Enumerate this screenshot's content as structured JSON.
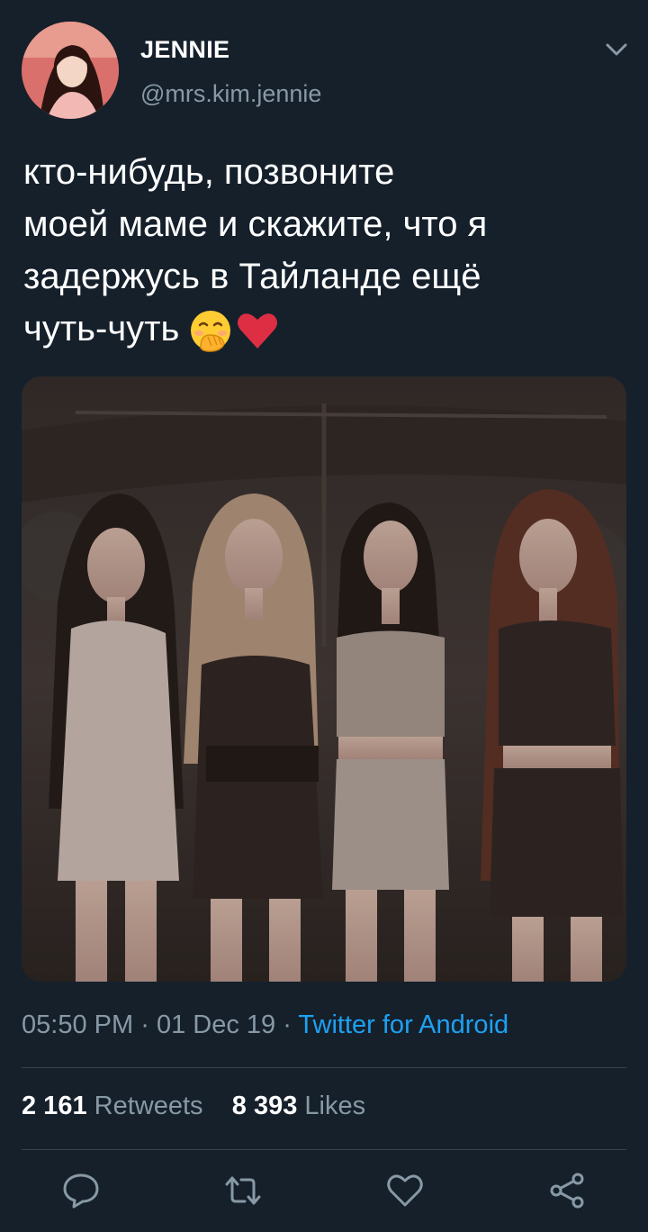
{
  "tweet": {
    "author": {
      "display_name": "JENNIE",
      "handle": "@mrs.kim.jennie"
    },
    "text_lines": [
      "кто-нибудь, позвоните",
      "моей маме и скажите, что я",
      "задержусь в Тайланде ещё",
      "чуть-чуть"
    ],
    "emojis": [
      "🤭",
      "❤️"
    ],
    "time": "05:50 PM",
    "date": "01 Dec 19",
    "source": "Twitter for Android",
    "separator": "·",
    "retweets_count": "2 161",
    "retweets_label": "Retweets",
    "likes_count": "8 393",
    "likes_label": "Likes"
  },
  "icons": {
    "menu": "chevron-down-icon",
    "reply": "reply-icon",
    "retweet": "retweet-icon",
    "like": "heart-icon",
    "share": "share-icon"
  },
  "colors": {
    "background": "#15202b",
    "secondary_text": "#8899a6",
    "link": "#1da1f2",
    "divider": "#38444d"
  }
}
